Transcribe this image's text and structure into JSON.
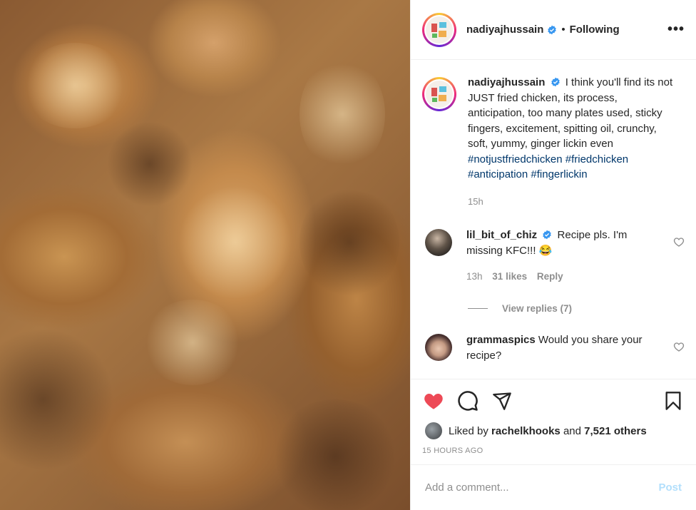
{
  "post": {
    "author": "nadiyajhussain",
    "separator": "•",
    "follow_status": "Following",
    "more_label": "•••"
  },
  "caption": {
    "username": "nadiyajhussain",
    "text": "I think you'll find its not JUST fried chicken, its process, anticipation, too many plates used, sticky fingers, excitement, spitting oil, crunchy, soft, yummy, ginger lickin even",
    "hashtags": [
      "#notjustfriedchicken",
      "#friedchicken",
      "#anticipation",
      "#fingerlickin"
    ],
    "time": "15h"
  },
  "comments": [
    {
      "username": "lil_bit_of_chiz",
      "text": "Recipe pls. I'm missing KFC!!! 😂",
      "time": "13h",
      "likes": "31 likes",
      "reply": "Reply",
      "view_replies": "View replies (7)"
    },
    {
      "username": "grammaspics",
      "text": "Would you share your recipe?"
    }
  ],
  "likes": {
    "prefix": "Liked by",
    "user": "rachelkhooks",
    "and": "and",
    "others": "7,521 others"
  },
  "posted": "15 HOURS AGO",
  "add_comment": {
    "placeholder": "Add a comment...",
    "post_label": "Post"
  },
  "colors": {
    "liked_heart": "#ed4956",
    "verified": "#3897f0",
    "hashtag": "#00376b",
    "post_disabled": "#b2dffc"
  },
  "icons": {
    "heart": "heart-filled-icon",
    "comment": "comment-bubble-icon",
    "share": "paper-plane-icon",
    "save": "bookmark-icon",
    "verified": "verified-badge-icon",
    "comment_like": "heart-outline-icon"
  }
}
